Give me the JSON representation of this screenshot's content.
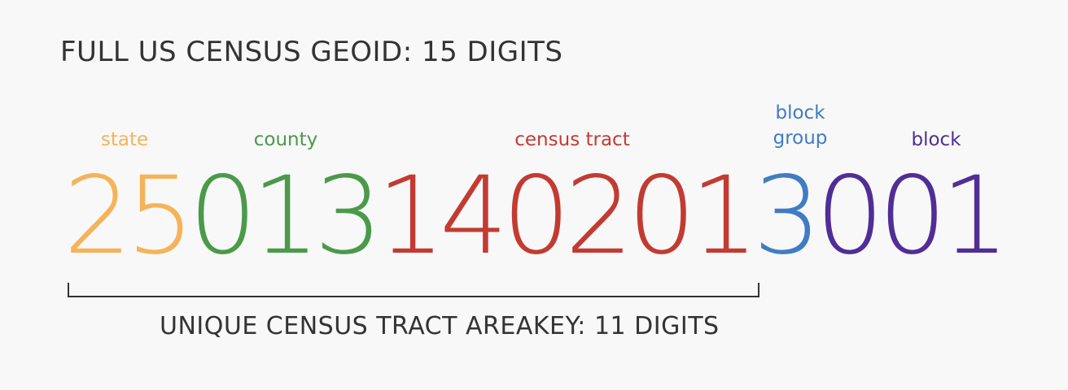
{
  "title": "FULL US CENSUS GEOID: 15 DIGITS",
  "colors": {
    "state": "#f5b35a",
    "county": "#4a9a4a",
    "tract": "#c23b32",
    "block_group": "#3f7cc3",
    "block": "#4f2e96"
  },
  "labels": {
    "state": "state",
    "county": "county",
    "tract": "census tract",
    "block_group_line1": "block",
    "block_group_line2": "group",
    "block": "block"
  },
  "digits": {
    "state": [
      "2",
      "5"
    ],
    "county": [
      "0",
      "1",
      "3"
    ],
    "tract": [
      "1",
      "4",
      "0",
      "2",
      "0",
      "1"
    ],
    "block_group": [
      "3"
    ],
    "block": [
      "0",
      "0",
      "1"
    ]
  },
  "bracket_label": "UNIQUE CENSUS TRACT AREAKEY: 11 DIGITS"
}
